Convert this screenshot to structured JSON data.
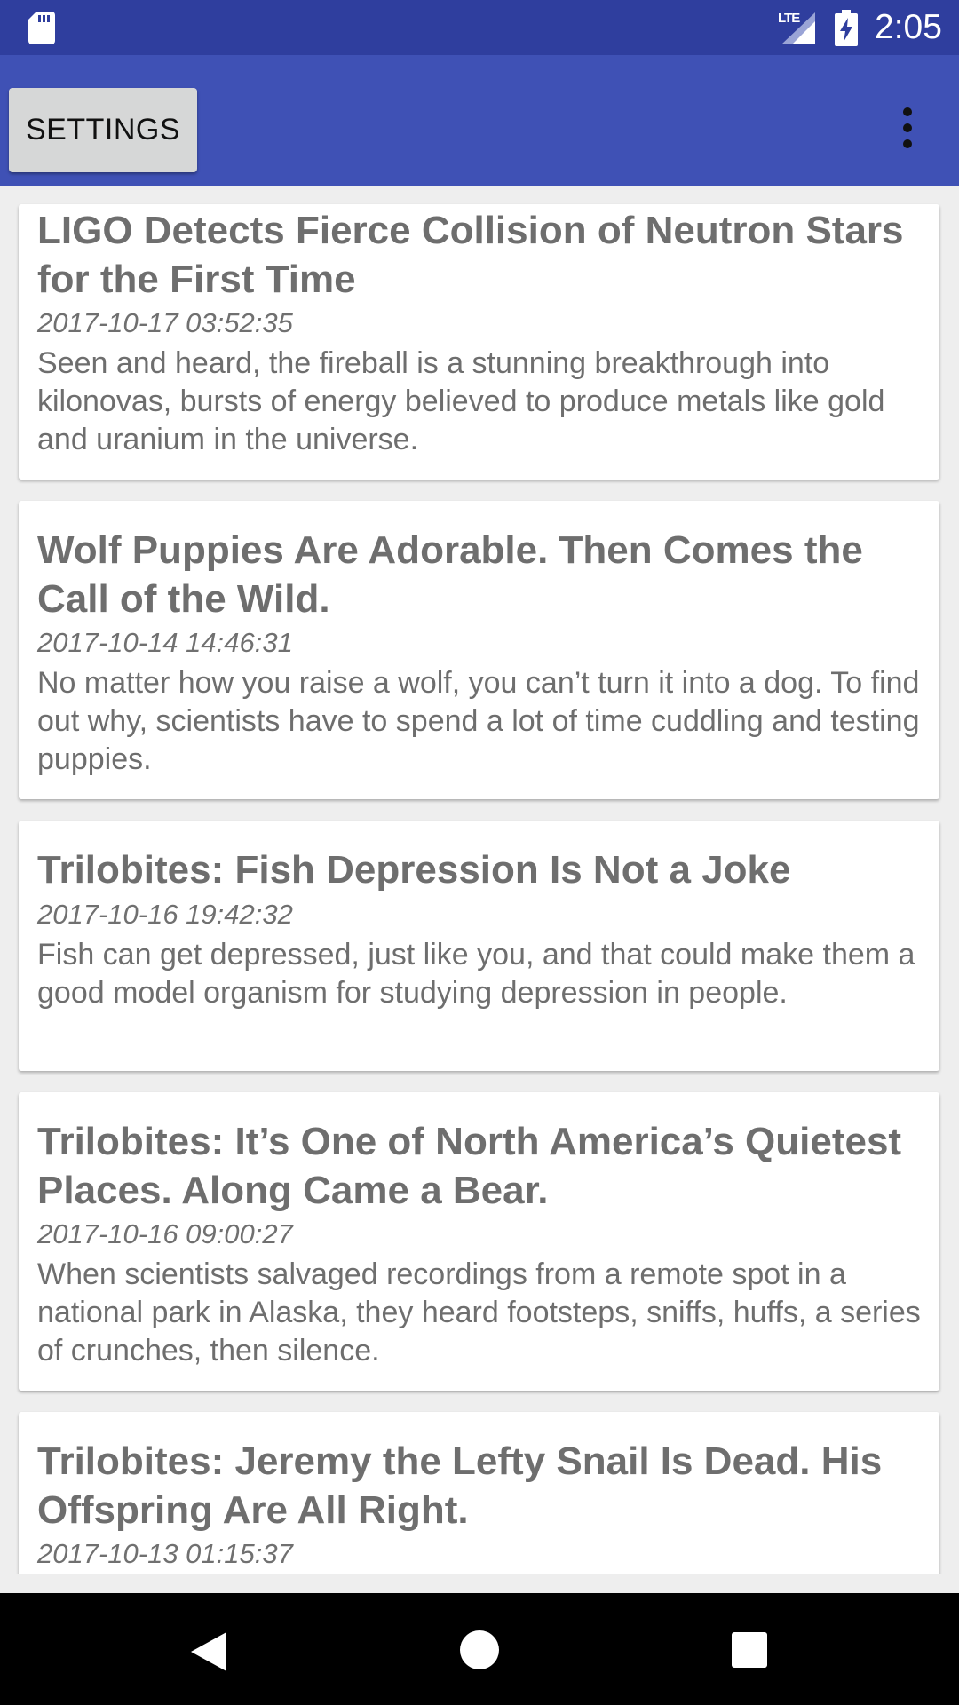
{
  "status_bar": {
    "time": "2:05",
    "network_label": "LTE",
    "icons": [
      "sd-card-icon",
      "lte-signal-icon",
      "battery-charging-icon"
    ]
  },
  "app_bar": {
    "settings_label": "SETTINGS",
    "overflow_icon": "more-vert-icon"
  },
  "articles": [
    {
      "title": "LIGO Detects Fierce Collision of Neutron Stars for the First Time",
      "date": "2017-10-17 03:52:35",
      "summary": "Seen and heard, the fireball is a stunning breakthrough into kilonovas, bursts of energy believed to produce metals like gold and uranium in the universe."
    },
    {
      "title": "Wolf Puppies Are Adorable. Then Comes the Call of the Wild.",
      "date": "2017-10-14 14:46:31",
      "summary": "No matter how you raise a wolf, you can’t turn it into a dog. To find out why, scientists have to spend a lot of time cuddling and testing puppies."
    },
    {
      "title": "Trilobites: Fish Depression Is Not a Joke",
      "date": "2017-10-16 19:42:32",
      "summary": "Fish can get depressed, just like you, and that could make them a good model organism for studying depression in people."
    },
    {
      "title": "Trilobites: It’s One of North America’s Quietest Places. Along Came a Bear.",
      "date": "2017-10-16 09:00:27",
      "summary": "When scientists salvaged recordings from a remote spot in a national park in Alaska, they heard footsteps, sniffs, huffs, a series of crunches, then silence."
    },
    {
      "title": "Trilobites: Jeremy the Lefty Snail Is Dead. His Offspring Are All Right.",
      "date": "2017-10-13 01:15:37",
      "summary": ""
    }
  ],
  "nav_bar": {
    "icons": [
      "back-icon",
      "home-icon",
      "recents-icon"
    ]
  }
}
